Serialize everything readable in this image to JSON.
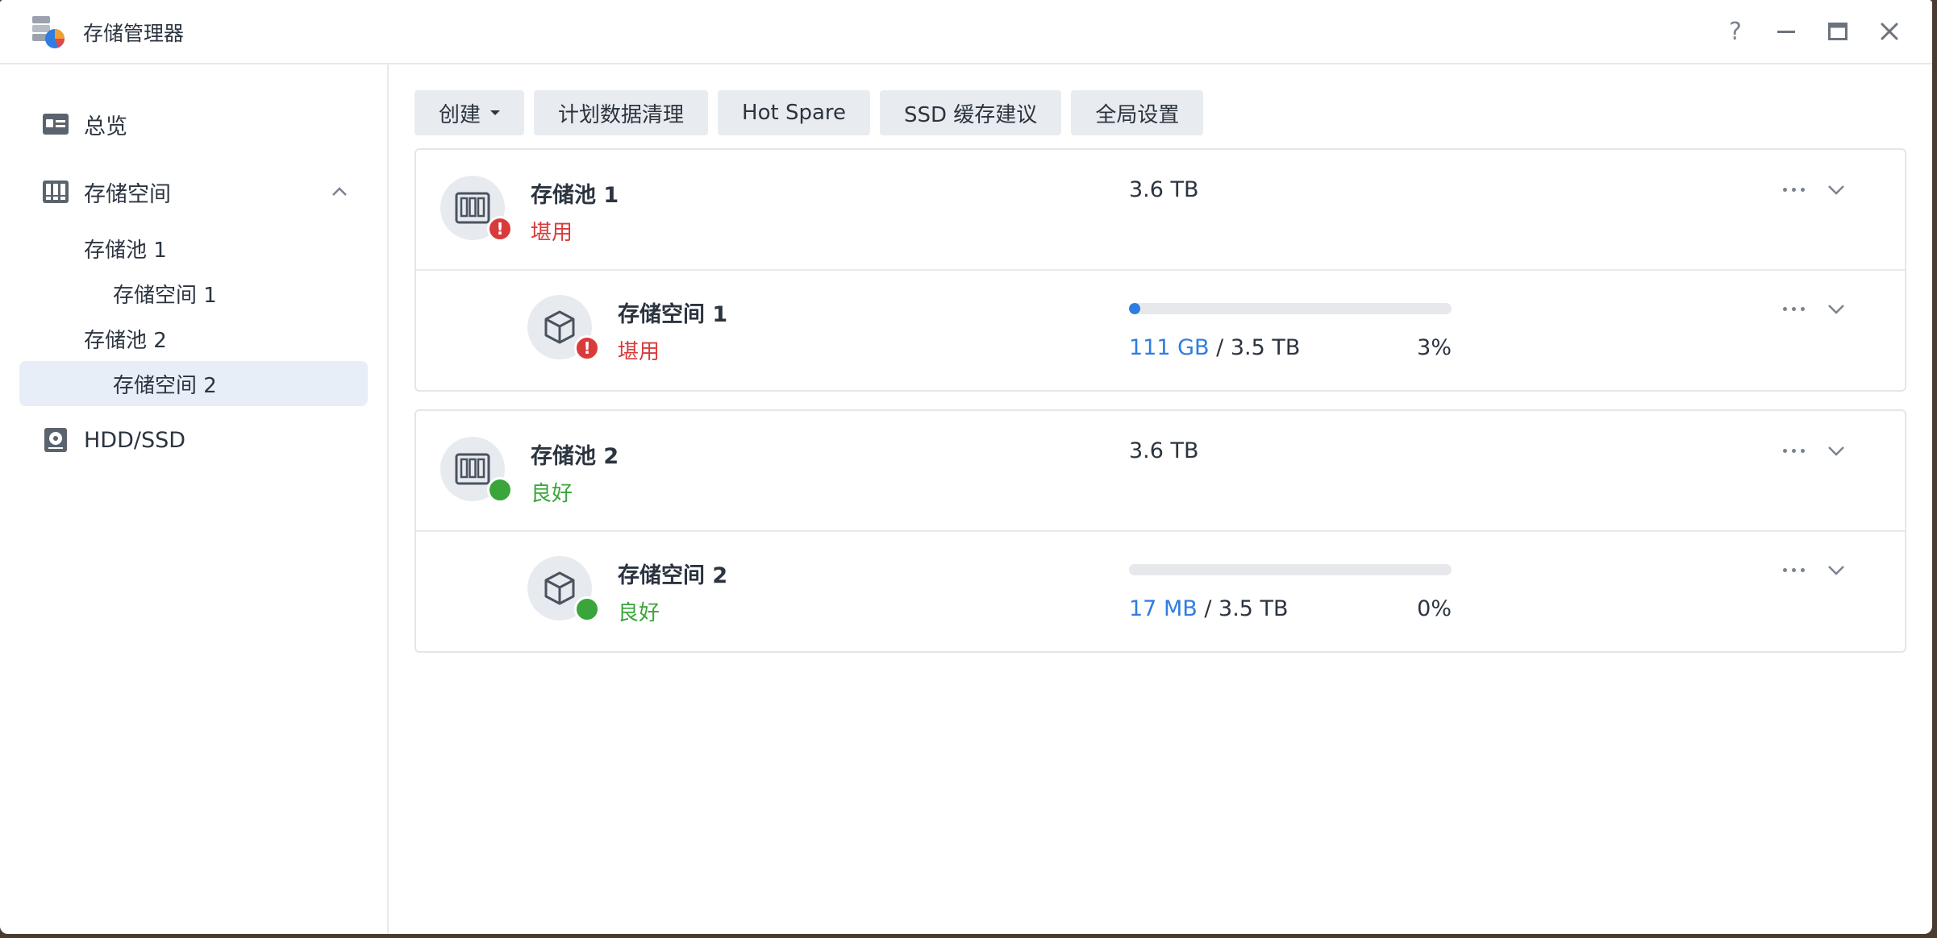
{
  "window": {
    "title": "存储管理器",
    "controls": [
      "help-icon",
      "minimize-icon",
      "maximize-icon",
      "close-icon"
    ],
    "help_glyph": "?"
  },
  "sidebar": {
    "items": [
      {
        "label": "总览",
        "icon": "overview-icon"
      },
      {
        "label": "存储空间",
        "icon": "storage-icon",
        "expanded": true
      },
      {
        "label": "存储池 1"
      },
      {
        "label": "存储空间 1"
      },
      {
        "label": "存储池 2"
      },
      {
        "label": "存储空间 2",
        "selected": true
      },
      {
        "label": "HDD/SSD",
        "icon": "disk-icon"
      }
    ]
  },
  "toolbar": {
    "create": "创建",
    "scrub": "计划数据清理",
    "hot_spare": "Hot Spare",
    "ssd_cache": "SSD 缓存建议",
    "global_settings": "全局设置"
  },
  "pools": [
    {
      "name": "存储池 1",
      "status": "堪用",
      "status_level": "warning",
      "capacity": "3.6 TB",
      "volume": {
        "name": "存储空间 1",
        "status": "堪用",
        "used": "111 GB",
        "separator": " / ",
        "total": "3.5 TB",
        "percent": "3%",
        "usage_fraction": 0.03
      }
    },
    {
      "name": "存储池 2",
      "status": "良好",
      "status_level": "good",
      "capacity": "3.6 TB",
      "volume": {
        "name": "存储空间 2",
        "status": "良好",
        "used": "17 MB",
        "separator": " / ",
        "total": "3.5 TB",
        "percent": "0%",
        "usage_fraction": 0.0
      }
    }
  ],
  "colors": {
    "accent": "#2f7de1",
    "warning": "#d93b3b",
    "good": "#3aa53a",
    "selected_bg": "#e8eef8"
  }
}
